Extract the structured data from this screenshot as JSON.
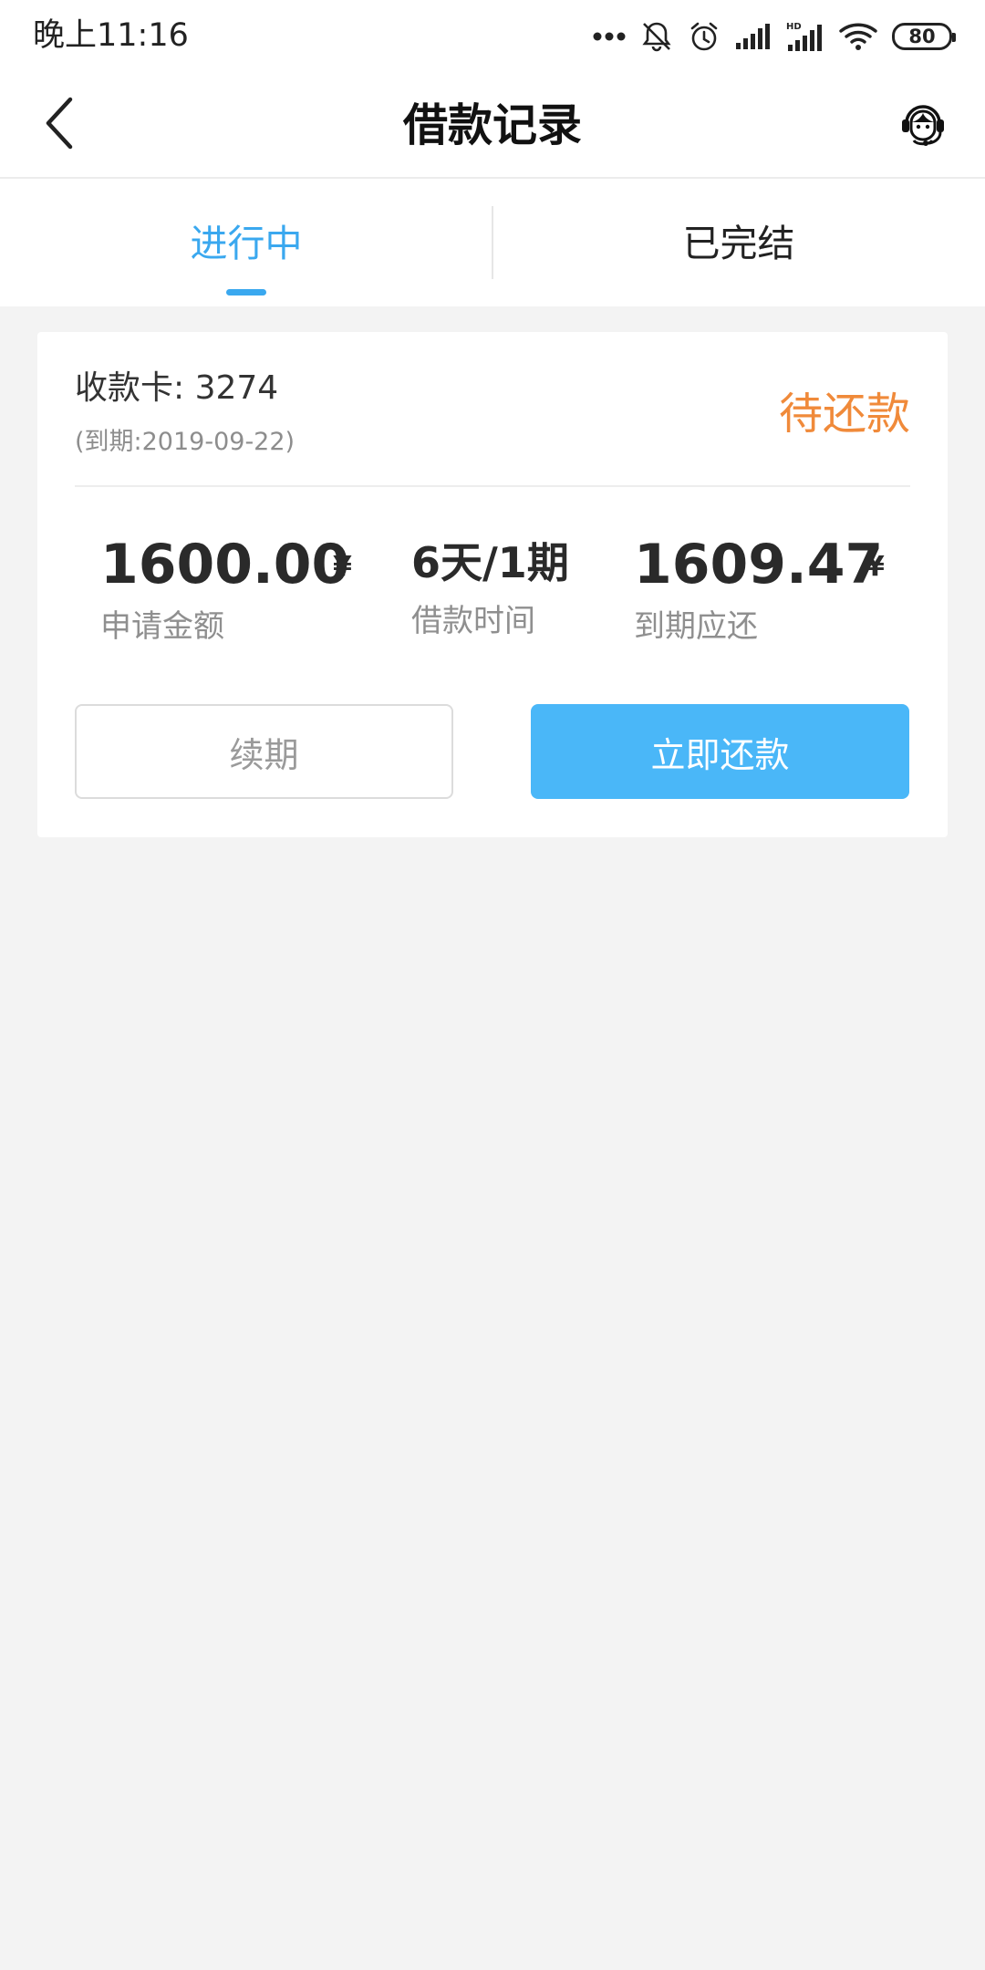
{
  "status_bar": {
    "time": "晚上11:16",
    "battery": "80",
    "icons": [
      "more-dots-icon",
      "muted-bell-icon",
      "alarm-icon",
      "signal-icon",
      "hd-signal-icon",
      "wifi-icon",
      "battery-icon"
    ],
    "network_label": "HD"
  },
  "header": {
    "title": "借款记录",
    "back_icon": "chevron-left-icon",
    "support_icon": "customer-service-icon"
  },
  "tabs": [
    {
      "label": "进行中",
      "active": true
    },
    {
      "label": "已完结",
      "active": false
    }
  ],
  "loan": {
    "card_label": "收款卡: 3274",
    "due_date": "(到期:2019-09-22)",
    "status": "待还款",
    "amount": "1600.00",
    "amount_currency": "¥",
    "amount_label": "申请金额",
    "term": "6天/1期",
    "term_label": "借款时间",
    "due_amount": "1609.47",
    "due_currency": "¥",
    "due_label": "到期应还",
    "renew_button": "续期",
    "repay_button": "立即还款"
  },
  "colors": {
    "accent": "#3aa8ef",
    "repay_button": "#4ab7f8",
    "status": "#f08a3a",
    "background": "#f3f3f3"
  }
}
